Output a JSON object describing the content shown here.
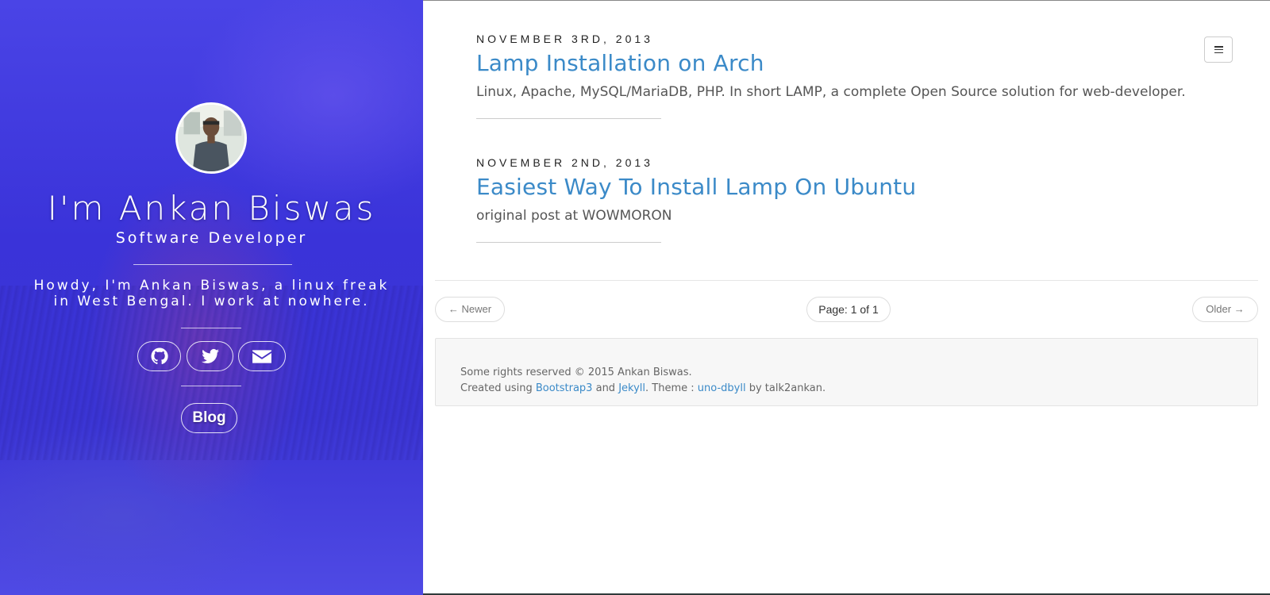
{
  "sidebar": {
    "name": "I'm Ankan Biswas",
    "role": "Software Developer",
    "bio": "Howdy, I'm Ankan Biswas, a linux freak in West Bengal. I work at nowhere.",
    "social": [
      {
        "icon": "github-icon"
      },
      {
        "icon": "twitter-icon"
      },
      {
        "icon": "envelope-icon"
      }
    ],
    "blog_label": "Blog"
  },
  "posts": [
    {
      "date": "November 3rd, 2013",
      "title": "Lamp Installation on Arch",
      "excerpt": "Linux, Apache, MySQL/MariaDB, PHP. In short LAMP, a complete Open Source solution for web-developer."
    },
    {
      "date": "November 2nd, 2013",
      "title": "Easiest Way To Install Lamp On Ubuntu",
      "excerpt": "original post at WOWMORON"
    }
  ],
  "pager": {
    "newer": "← Newer",
    "page": "Page: 1 of 1",
    "older": "Older →"
  },
  "footer": {
    "rights": "Some rights reserved © 2015 Ankan Biswas.",
    "created_prefix": "Created using ",
    "link1": "Bootstrap3",
    "and": " and ",
    "link2": "Jekyll",
    "theme_prefix": ". Theme : ",
    "link3": "uno-dbyll",
    "suffix": " by talk2ankan."
  },
  "colors": {
    "sidebar_bg": "#3f3adb",
    "link": "#3b8ac8",
    "text": "#555555"
  }
}
